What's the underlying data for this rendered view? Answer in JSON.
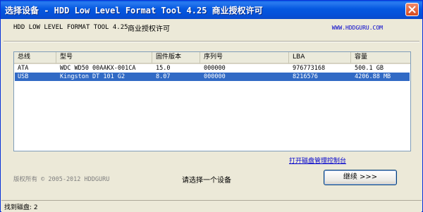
{
  "window": {
    "title": "选择设备 - HDD Low Level Format Tool 4.25     商业授权许可"
  },
  "header": {
    "product": "HDD LOW LEVEL FORMAT TOOL 4.25",
    "license": "商业授权许可",
    "website": "WWW.HDDGURU.COM"
  },
  "table": {
    "columns": [
      "总线",
      "型号",
      "固件版本",
      "序列号",
      "LBA",
      "容量"
    ],
    "rows": [
      [
        "ATA",
        "WDC WD50 00AAKX-001CA",
        "15.0",
        "000000",
        "976773168",
        "500.1 GB"
      ],
      [
        "USB",
        "Kingston DT 101 G2",
        "8.07",
        "000000",
        "8216576",
        "4206.88 MB"
      ]
    ],
    "selected_row": 2
  },
  "footer": {
    "disk_mgmt_link": "打开磁盘管理控制台",
    "copyright": "版权所有 © 2005-2012 HDDGURU",
    "prompt": "请选择一个设备",
    "continue_label": "继续 >>>"
  },
  "status": {
    "found_disks": "找到磁盘: 2"
  },
  "colors": {
    "title_bar": "#0558e0",
    "selection": "#316ac5",
    "link": "#0000cc",
    "window_bg": "#ece9d8"
  }
}
